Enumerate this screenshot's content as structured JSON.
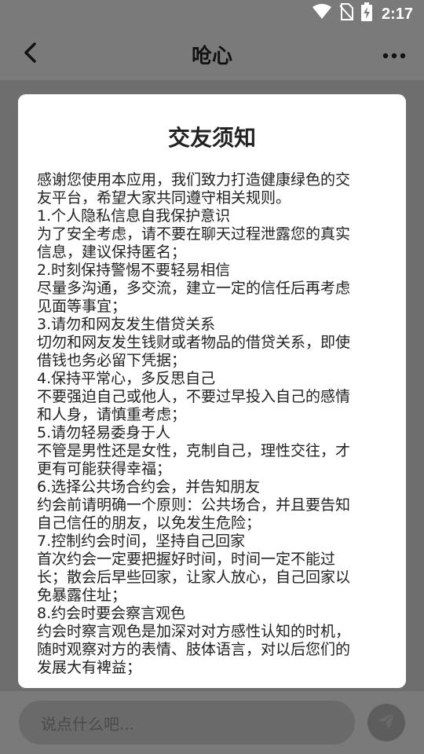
{
  "status_bar": {
    "time": "2:17",
    "icons": [
      "wifi-icon",
      "no-sim-icon",
      "battery-charging-icon"
    ]
  },
  "app_bar": {
    "title": "呛心",
    "back_icon": "chevron-left-icon",
    "more_icon": "more-horizontal-icon"
  },
  "modal": {
    "title": "交友须知",
    "lines": [
      "感谢您使用本应用，我们致力打造健康绿色的交",
      "友平台，希望大家共同遵守相关规则。",
      "1.个人隐私信息自我保护意识",
      "为了安全考虑，请不要在聊天过程泄露您的真实",
      "信息，建议保持匿名；",
      "2.时刻保持警惕不要轻易相信",
      "尽量多沟通，多交流，建立一定的信任后再考虑",
      "见面等事宜；",
      "3.请勿和网友发生借贷关系",
      "切勿和网友发生钱财或者物品的借贷关系，即使",
      "借钱也务必留下凭据；",
      "4.保持平常心，多反思自己",
      "不要强迫自己或他人，不要过早投入自己的感情",
      "和人身，请慎重考虑；",
      "5.请勿轻易委身于人",
      "不管是男性还是女性，克制自己，理性交往，才",
      "更有可能获得幸福；",
      "6.选择公共场合约会，并告知朋友",
      "约会前请明确一个原则：公共场合，并且要告知",
      "自己信任的朋友，以免发生危险；",
      "7.控制约会时间，坚持自己回家",
      "首次约会一定要把握好时间，时间一定不能过",
      "长；散会后早些回家，让家人放心，自己回家以",
      "免暴露住址；",
      "8.约会时要会察言观色",
      "约会时察言观色是加深对对方感性认知的时机，",
      "随时观察对方的表情、肢体语言，对以后您们的",
      "发展大有裨益；"
    ]
  },
  "input_bar": {
    "placeholder": "说点什么吧...",
    "send_icon": "send-icon"
  },
  "colors": {
    "overlay": "#7a7a7a",
    "modal_bg": "#ffffff",
    "text": "#222222"
  }
}
